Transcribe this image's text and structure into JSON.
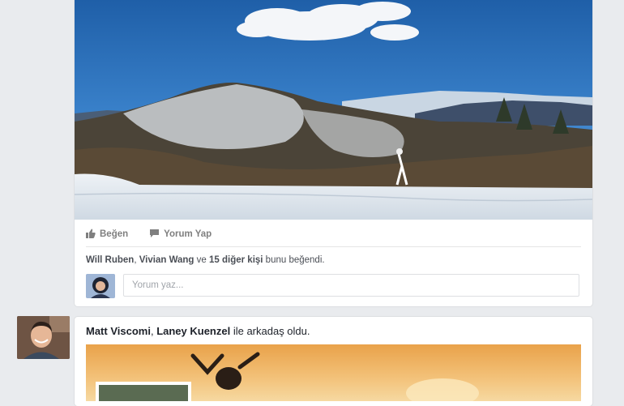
{
  "post": {
    "actions": {
      "like_label": "Beğen",
      "comment_label": "Yorum Yap"
    },
    "likes": {
      "name1": "Will Ruben",
      "separator": ", ",
      "name2": "Vivian Wang",
      "connector": " ve ",
      "others": "15 diğer kişi",
      "suffix": " bunu beğendi."
    },
    "comment": {
      "placeholder": "Yorum yaz..."
    }
  },
  "story": {
    "name1": "Matt Viscomi",
    "separator": ", ",
    "name2": "Laney Kuenzel",
    "suffix": " ile arkadaş oldu."
  },
  "icons": {
    "like": "thumbs-up-icon",
    "comment": "speech-bubble-icon"
  },
  "colors": {
    "background": "#e9ebee",
    "card": "#ffffff",
    "action_text": "#7f7f7f",
    "name_text": "#4b4f56"
  }
}
